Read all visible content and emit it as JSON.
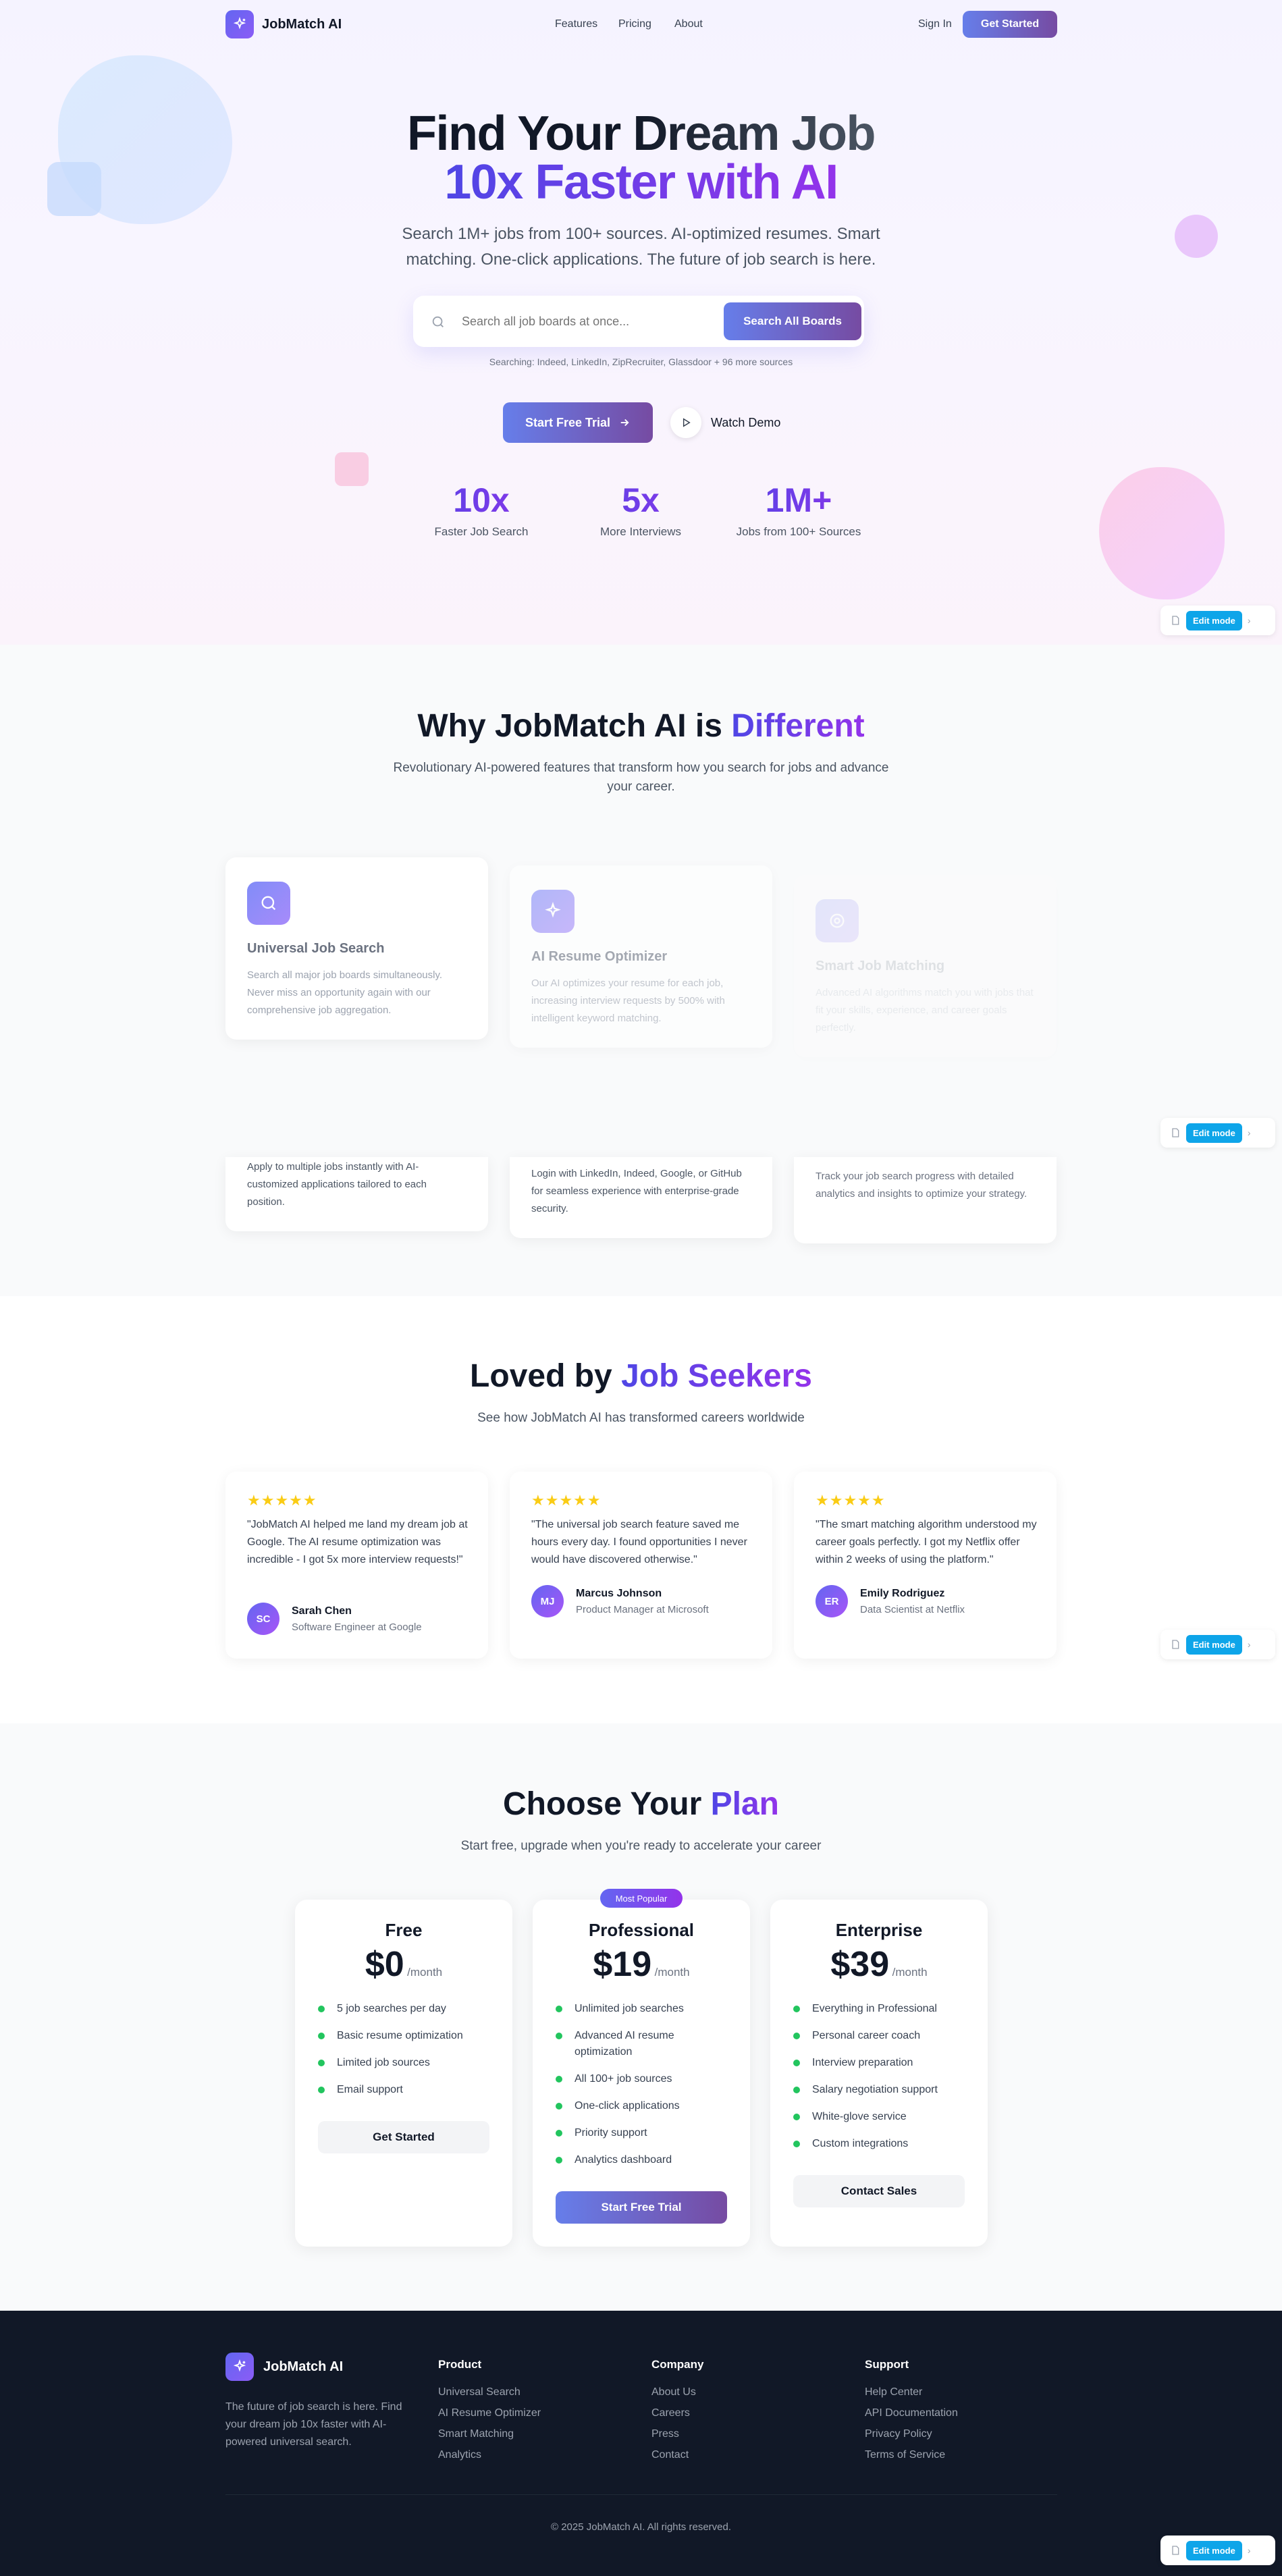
{
  "nav": {
    "brand": "JobMatch AI",
    "links": [
      "Features",
      "Pricing",
      "About"
    ],
    "signin": "Sign In",
    "cta": "Get Started"
  },
  "hero": {
    "line1a": "Find Your ",
    "line1b": "Dream Job",
    "line2": "10x Faster with AI",
    "sub1": "Search 1M+ jobs from 100+ sources. AI-optimized resumes. Smart",
    "sub2": "matching. One-click applications. The future of job search is here.",
    "search_placeholder": "Search all job boards at once...",
    "search_button": "Search All Boards",
    "sources": "Searching: Indeed, LinkedIn, ZipRecruiter, Glassdoor + 96 more sources",
    "trial": "Start Free Trial",
    "demo": "Watch Demo",
    "stats": [
      {
        "num": "10x",
        "label": "Faster Job Search"
      },
      {
        "num": "5x",
        "label": "More Interviews"
      },
      {
        "num": "1M+",
        "label": "Jobs from 100+ Sources"
      }
    ]
  },
  "edit": {
    "label": "Edit mode"
  },
  "features": {
    "title_a": "Why JobMatch AI is ",
    "title_b": "Different",
    "sub1": "Revolutionary AI-powered features that transform how you search for jobs and advance",
    "sub2": "your career.",
    "cards": [
      {
        "title": "Universal Job Search",
        "text": "Search all major job boards simultaneously. Never miss an opportunity again with our comprehensive job aggregation."
      },
      {
        "title": "AI Resume Optimizer",
        "text": "Our AI optimizes your resume for each job, increasing interview requests by 500% with intelligent keyword matching."
      },
      {
        "title": "Smart Job Matching",
        "text": "Advanced AI algorithms match you with jobs that fit your skills, experience, and career goals perfectly."
      }
    ],
    "cards2": [
      {
        "text": "Apply to multiple jobs instantly with AI-customized applications tailored to each position."
      },
      {
        "text": "Login with LinkedIn, Indeed, Google, or GitHub for seamless experience with enterprise-grade security."
      },
      {
        "text": "Track your job search progress with detailed analytics and insights to optimize your strategy."
      }
    ]
  },
  "testimonials": {
    "title_a": "Loved by ",
    "title_b": "Job Seekers",
    "sub": "See how JobMatch AI has transformed careers worldwide",
    "stars": "★★★★★",
    "items": [
      {
        "quote": "\"JobMatch AI helped me land my dream job at Google. The AI resume optimization was incredible - I got 5x more interview requests!\"",
        "initials": "SC",
        "name": "Sarah Chen",
        "role": "Software Engineer at Google"
      },
      {
        "quote": "\"The universal job search feature saved me hours every day. I found opportunities I never would have discovered otherwise.\"",
        "initials": "MJ",
        "name": "Marcus Johnson",
        "role": "Product Manager at Microsoft"
      },
      {
        "quote": "\"The smart matching algorithm understood my career goals perfectly. I got my Netflix offer within 2 weeks of using the platform.\"",
        "initials": "ER",
        "name": "Emily Rodriguez",
        "role": "Data Scientist at Netflix"
      }
    ]
  },
  "pricing": {
    "title_a": "Choose Your ",
    "title_b": "Plan",
    "sub": "Start free, upgrade when you're ready to accelerate your career",
    "badge": "Most Popular",
    "plans": [
      {
        "name": "Free",
        "price": "$0",
        "per": "/month",
        "features": [
          "5 job searches per day",
          "Basic resume optimization",
          "Limited job sources",
          "Email support"
        ],
        "cta": "Get Started"
      },
      {
        "name": "Professional",
        "price": "$19",
        "per": "/month",
        "features": [
          "Unlimited job searches",
          "Advanced AI resume optimization",
          "All 100+ job sources",
          "One-click applications",
          "Priority support",
          "Analytics dashboard"
        ],
        "cta": "Start Free Trial"
      },
      {
        "name": "Enterprise",
        "price": "$39",
        "per": "/month",
        "features": [
          "Everything in Professional",
          "Personal career coach",
          "Interview preparation",
          "Salary negotiation support",
          "White-glove service",
          "Custom integrations"
        ],
        "cta": "Contact Sales"
      }
    ]
  },
  "footer": {
    "brand": "JobMatch AI",
    "tagline": "The future of job search is here. Find your dream job 10x faster with AI-powered universal search.",
    "cols": [
      {
        "head": "Product",
        "links": [
          "Universal Search",
          "AI Resume Optimizer",
          "Smart Matching",
          "Analytics"
        ]
      },
      {
        "head": "Company",
        "links": [
          "About Us",
          "Careers",
          "Press",
          "Contact"
        ]
      },
      {
        "head": "Support",
        "links": [
          "Help Center",
          "API Documentation",
          "Privacy Policy",
          "Terms of Service"
        ]
      }
    ],
    "copyright": "© 2025 JobMatch AI. All rights reserved."
  }
}
